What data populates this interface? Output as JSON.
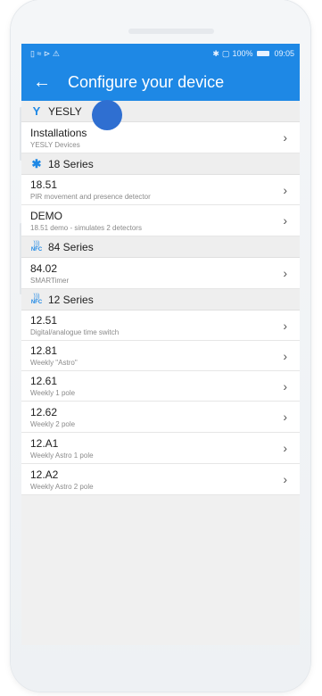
{
  "status": {
    "left_icons": "▯ ≈ ⊳ ⚠",
    "bt": "✱",
    "signal": "▢",
    "battery_percent": "100%",
    "time": "09:05"
  },
  "header": {
    "back": "←",
    "title": "Configure your device"
  },
  "sections": [
    {
      "label": "YESLY",
      "icon": "yesly-logo-icon",
      "items": [
        {
          "main": "Installations",
          "sub": "YESLY Devices"
        }
      ]
    },
    {
      "label": "18 Series",
      "icon": "bluetooth-icon",
      "items": [
        {
          "main": "18.51",
          "sub": "PIR movement and presence detector"
        },
        {
          "main": "DEMO",
          "sub": "18.51 demo - simulates 2 detectors"
        }
      ]
    },
    {
      "label": "84 Series",
      "icon": "nfc-icon",
      "items": [
        {
          "main": "84.02",
          "sub": "SMARTimer"
        }
      ]
    },
    {
      "label": "12 Series",
      "icon": "nfc-icon",
      "items": [
        {
          "main": "12.51",
          "sub": "Digital/analogue time switch"
        },
        {
          "main": "12.81",
          "sub": "Weekly \"Astro\""
        },
        {
          "main": "12.61",
          "sub": "Weekly 1 pole"
        },
        {
          "main": "12.62",
          "sub": "Weekly 2 pole"
        },
        {
          "main": "12.A1",
          "sub": "Weekly Astro 1 pole"
        },
        {
          "main": "12.A2",
          "sub": "Weekly Astro 2 pole"
        }
      ]
    }
  ],
  "colors": {
    "primary": "#1e88e5",
    "touch": "#2f6fd1"
  }
}
